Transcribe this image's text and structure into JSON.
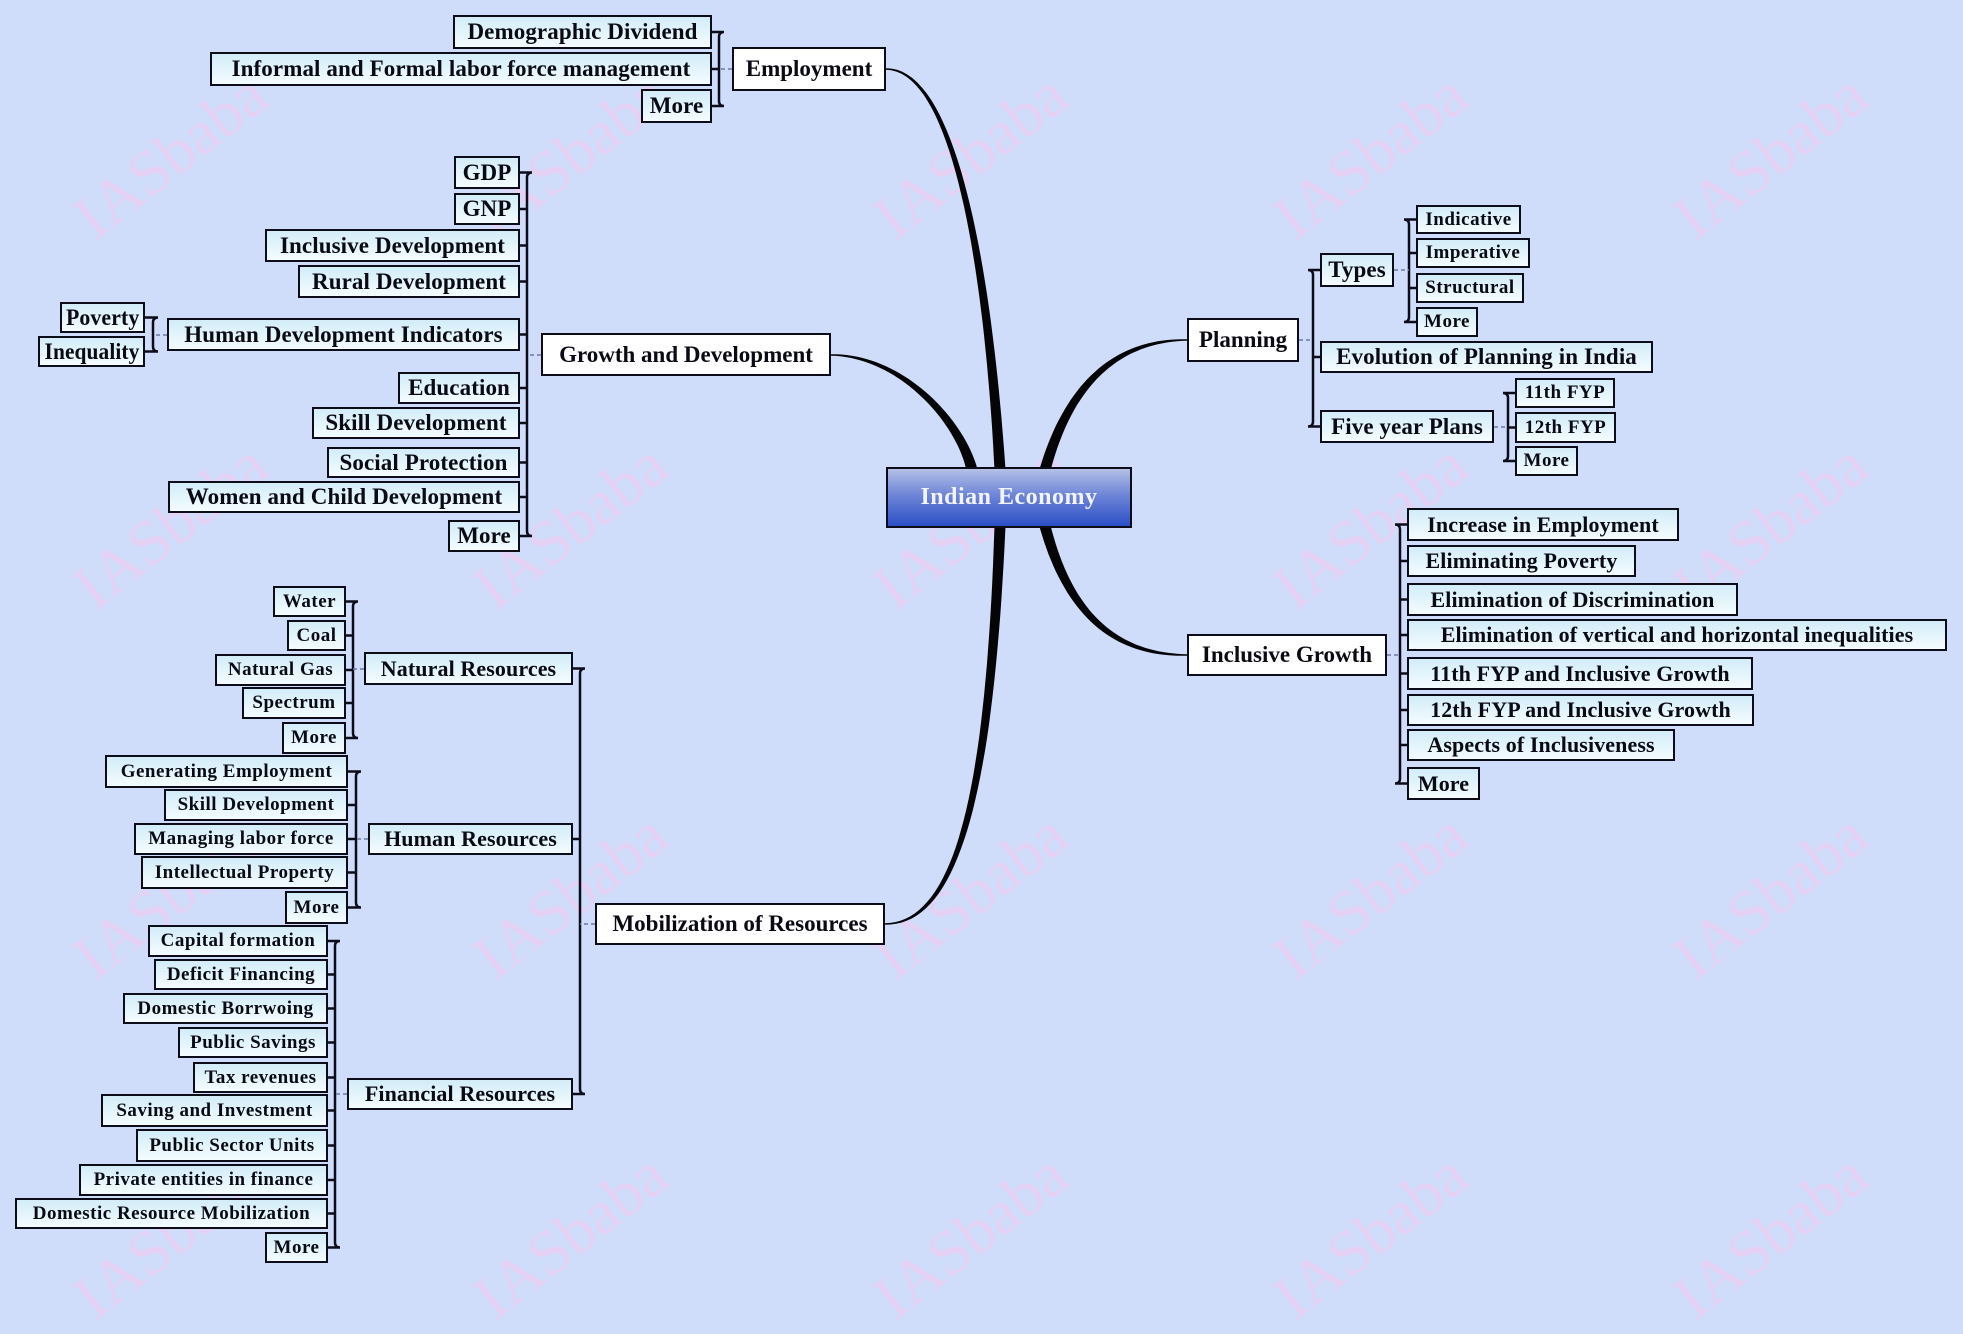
{
  "title": "Indian Economy",
  "watermark": "IASbaba",
  "colors": {
    "background": "#cfdcfa",
    "root_fill_top": "#b4c0e6",
    "root_fill_bottom": "#2b4fc6",
    "leaf_fill_top": "#d2ecf8",
    "leaf_fill_bottom": "#f4fcff",
    "border": "#0d0d1a",
    "watermark": "#ead0f2"
  },
  "root": {
    "label": "Indian Economy"
  },
  "branches": {
    "employment": {
      "label": "Employment",
      "children": [
        "Demographic Dividend",
        "Informal and Formal labor force management",
        "More"
      ]
    },
    "growth": {
      "label": "Growth and Development",
      "children": [
        "GDP",
        "GNP",
        "Inclusive Development",
        "Rural Development",
        "Human Development Indicators",
        "Education",
        "Skill Development",
        "Social Protection",
        "Women and Child Development",
        "More"
      ],
      "hdi_children": [
        "Poverty",
        "Inequality"
      ]
    },
    "planning": {
      "label": "Planning",
      "types": {
        "label": "Types",
        "children": [
          "Indicative",
          "Imperative",
          "Structural",
          "More"
        ]
      },
      "evolution": {
        "label": "Evolution of Planning in India"
      },
      "fyp": {
        "label": "Five year Plans",
        "children": [
          "11th FYP",
          "12th FYP",
          "More"
        ]
      }
    },
    "inclusive": {
      "label": "Inclusive Growth",
      "children": [
        "Increase in Employment",
        "Eliminating Poverty",
        "Elimination of Discrimination",
        "Elimination of vertical and horizontal inequalities",
        "11th FYP and Inclusive Growth",
        "12th FYP and Inclusive Growth",
        "Aspects of Inclusiveness",
        "More"
      ]
    },
    "mobilization": {
      "label": "Mobilization of Resources",
      "natural": {
        "label": "Natural Resources",
        "children": [
          "Water",
          "Coal",
          "Natural Gas",
          "Spectrum",
          "More"
        ]
      },
      "human": {
        "label": "Human Resources",
        "children": [
          "Generating Employment",
          "Skill Development",
          "Managing labor force",
          "Intellectual Property",
          "More"
        ]
      },
      "financial": {
        "label": "Financial Resources",
        "children": [
          "Capital formation",
          "Deficit Financing",
          "Domestic Borrwoing",
          "Public Savings",
          "Tax revenues",
          "Saving and Investment",
          "Public Sector Units",
          "Private entities in finance",
          "Domestic Resource Mobilization",
          "More"
        ]
      }
    }
  }
}
